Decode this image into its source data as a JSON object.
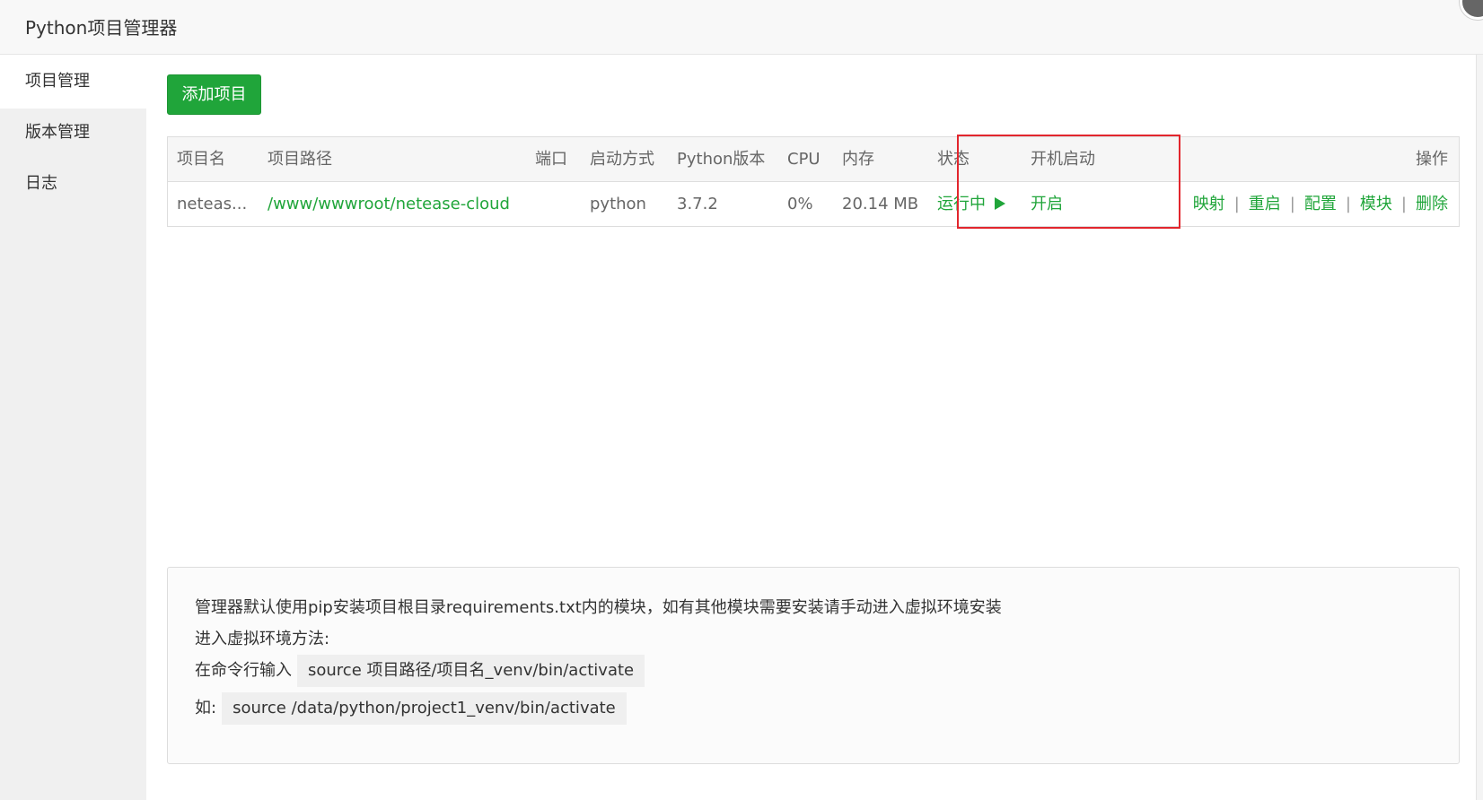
{
  "window": {
    "title": "Python项目管理器"
  },
  "sidebar": {
    "items": [
      {
        "label": "项目管理",
        "active": true
      },
      {
        "label": "版本管理",
        "active": false
      },
      {
        "label": "日志",
        "active": false
      }
    ]
  },
  "toolbar": {
    "add_label": "添加项目"
  },
  "table": {
    "headers": {
      "name": "项目名",
      "path": "项目路径",
      "port": "端口",
      "start_mode": "启动方式",
      "python_version": "Python版本",
      "cpu": "CPU",
      "memory": "内存",
      "status": "状态",
      "autostart": "开机启动",
      "actions": "操作"
    },
    "rows": [
      {
        "name": "neteas...",
        "path": "/www/wwwroot/netease-cloud",
        "port": "",
        "start_mode": "python",
        "python_version": "3.7.2",
        "cpu": "0%",
        "memory": "20.14 MB",
        "status": "运行中",
        "status_icon": "play-icon",
        "autostart": "开启",
        "actions": {
          "map": "映射",
          "restart": "重启",
          "config": "配置",
          "modules": "模块",
          "delete": "删除"
        }
      }
    ]
  },
  "tips": {
    "line1": "管理器默认使用pip安装项目根目录requirements.txt内的模块，如有其他模块需要安装请手动进入虚拟环境安装",
    "line2": "进入虚拟环境方法:",
    "line3_label": "在命令行输入",
    "line3_code": "source 项目路径/项目名_venv/bin/activate",
    "line4_label": "如:",
    "line4_code": "source /data/python/project1_venv/bin/activate"
  },
  "colors": {
    "accent": "#20a53a",
    "highlight": "#e2262d"
  }
}
